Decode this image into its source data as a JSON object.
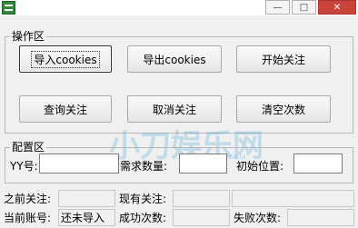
{
  "operation_group": {
    "title": "操作区"
  },
  "buttons": {
    "import": "导入cookies",
    "export": "导出cookies",
    "start": "开始关注",
    "query": "查询关注",
    "cancel": "取消关注",
    "clear": "清空次数"
  },
  "config_group": {
    "title": "配置区"
  },
  "config": {
    "yy_label": "YY号:",
    "yy_value": "",
    "demand_label": "需求数量:",
    "demand_value": "",
    "start_pos_label": "初始位置:",
    "start_pos_value": ""
  },
  "status": {
    "prev_follow_label": "之前关注:",
    "prev_follow_value": "",
    "current_follow_label": "现有关注:",
    "current_follow_value": "",
    "current_account_label": "当前账号:",
    "current_account_value": "还未导入",
    "success_count_label": "成功次数:",
    "success_count_value": "",
    "fail_count_label": "失败次数:",
    "fail_count_value": ""
  },
  "watermark": {
    "text": "小刀娱乐网",
    "url": "www.xiaodao.la"
  }
}
